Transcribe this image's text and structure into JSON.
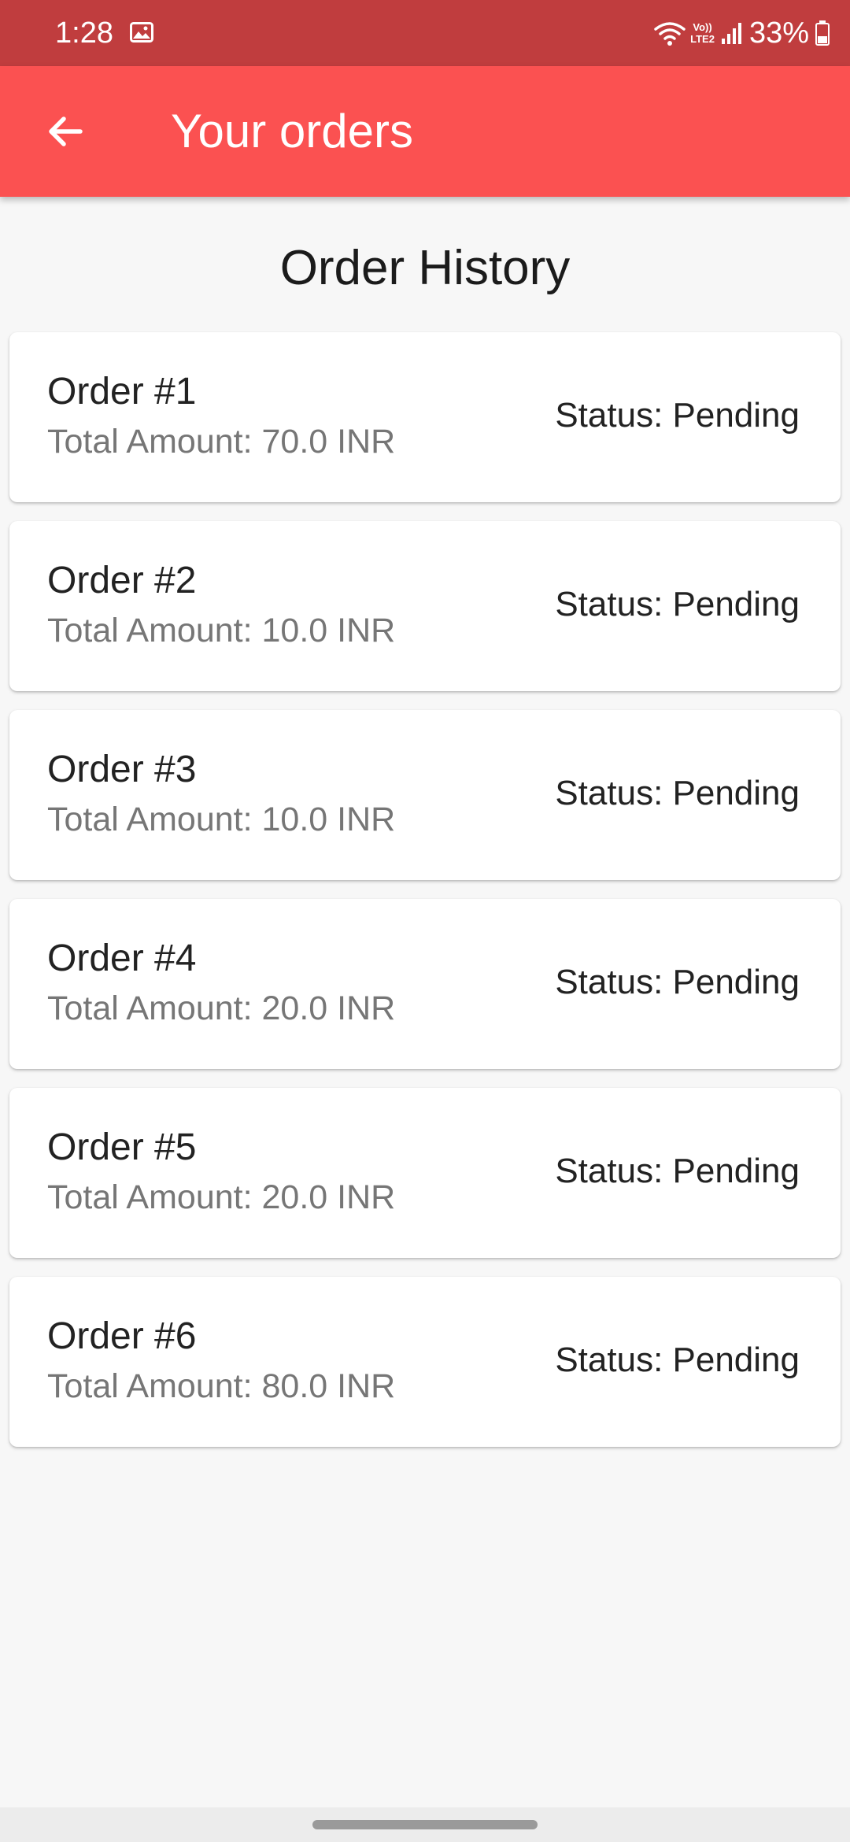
{
  "status_bar": {
    "time": "1:28",
    "lte_top": "Vo))",
    "lte_bottom": "LTE2",
    "battery": "33%"
  },
  "app_bar": {
    "title": "Your orders",
    "back_icon": "arrow-back-icon",
    "background_color": "#fb5151"
  },
  "page": {
    "heading": "Order History"
  },
  "orders": [
    {
      "title": "Order #1",
      "amount": "Total Amount: 70.0 INR",
      "status": "Status: Pending"
    },
    {
      "title": "Order #2",
      "amount": "Total Amount: 10.0 INR",
      "status": "Status: Pending"
    },
    {
      "title": "Order #3",
      "amount": "Total Amount: 10.0 INR",
      "status": "Status: Pending"
    },
    {
      "title": "Order #4",
      "amount": "Total Amount: 20.0 INR",
      "status": "Status: Pending"
    },
    {
      "title": "Order #5",
      "amount": "Total Amount: 20.0 INR",
      "status": "Status: Pending"
    },
    {
      "title": "Order #6",
      "amount": "Total Amount: 80.0 INR",
      "status": "Status: Pending"
    }
  ]
}
